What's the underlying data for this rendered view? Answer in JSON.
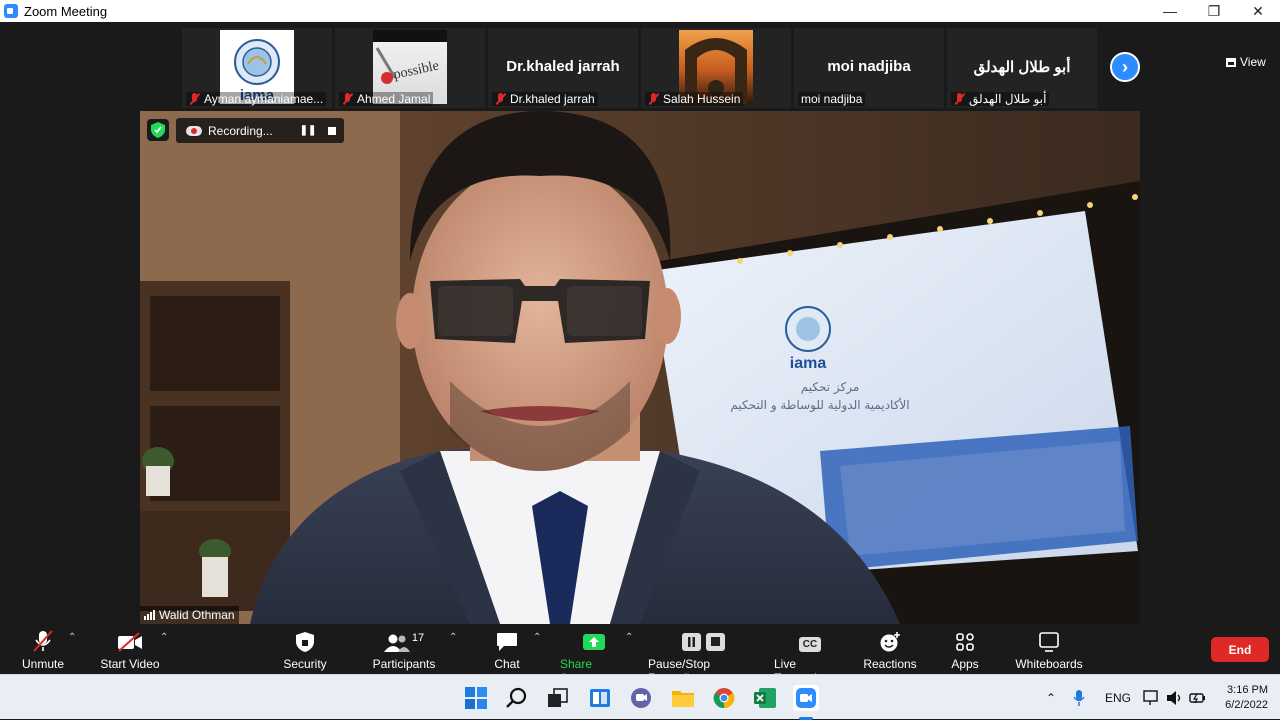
{
  "window": {
    "title": "Zoom Meeting"
  },
  "gallery": {
    "view_label": "View",
    "participants": [
      {
        "name": "Ayman aymaniamae...",
        "muted": true,
        "kind": "logo",
        "logo_text": "iama"
      },
      {
        "name": "Ahmed Jamal",
        "muted": true,
        "kind": "image",
        "image_text": "possible"
      },
      {
        "name": "Dr.khaled jarrah",
        "muted": true,
        "kind": "text",
        "display": "Dr.khaled jarrah"
      },
      {
        "name": "Salah Hussein",
        "muted": true,
        "kind": "photo"
      },
      {
        "name": "moi nadjiba",
        "muted": false,
        "kind": "text",
        "display": "moi nadjiba"
      },
      {
        "name": "أبو طلال الهدلق",
        "muted": true,
        "kind": "text",
        "display": "أبو طلال الهدلق"
      }
    ]
  },
  "video": {
    "speaker": "Walid Othman",
    "recording_label": "Recording...",
    "screen_logo": "iama",
    "screen_line1": "مركز تحكيم",
    "screen_line2": "الأكاديمية الدولية للوساطة و التحكيم"
  },
  "toolbar": {
    "unmute": "Unmute",
    "start_video": "Start Video",
    "security": "Security",
    "participants": "Participants",
    "participants_count": "17",
    "chat": "Chat",
    "share_screen": "Share Screen",
    "pause_stop_recording": "Pause/Stop Recording",
    "live_transcript": "Live Transcript",
    "cc": "CC",
    "reactions": "Reactions",
    "apps": "Apps",
    "whiteboards": "Whiteboards",
    "end": "End"
  },
  "taskbar": {
    "language": "ENG",
    "time": "3:16 PM",
    "date": "6/2/2022"
  },
  "colors": {
    "accent": "#2d8cff",
    "end": "#e02828",
    "share": "#23d959"
  }
}
